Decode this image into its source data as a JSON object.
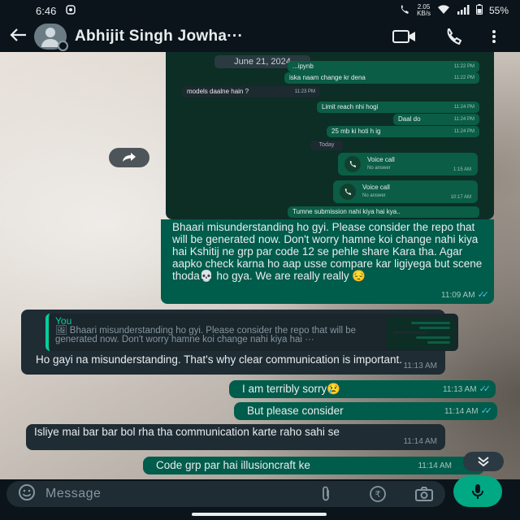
{
  "status_bar": {
    "time": "6:46",
    "net_speed_value": "2.05",
    "net_speed_unit": "KB/s",
    "battery": "55%"
  },
  "header": {
    "contact_name": "Abhijit Singh Jowha···"
  },
  "forwarded_screenshot": {
    "date_chip": "June 21, 2024",
    "messages": [
      {
        "text": "...ipynb",
        "time": "11:22 PM",
        "dir": "out"
      },
      {
        "text": "iska naam change kr dena",
        "time": "11:22 PM",
        "dir": "out"
      },
      {
        "text": "models daalne hain ?",
        "time": "11:23 PM",
        "dir": "in"
      },
      {
        "text": "Limit reach nhi hogi",
        "time": "11:24 PM",
        "dir": "out"
      },
      {
        "text": "Daal do",
        "time": "11:24 PM",
        "dir": "out"
      },
      {
        "text": "25 mb ki hoti h ig",
        "time": "11:24 PM",
        "dir": "out"
      }
    ],
    "today_chip": "Today",
    "calls": [
      {
        "title": "Voice call",
        "status": "No answer",
        "time": "1:15 AM"
      },
      {
        "title": "Voice call",
        "status": "No answer",
        "time": "10:17 AM"
      }
    ],
    "last_line": "Tumne submission nahi kiya hai kya.."
  },
  "messages": [
    {
      "dir": "out",
      "text": "Bhaari misunderstanding ho gyi. Please consider the repo that will be generated now. Don't worry hamne koi change nahi kiya hai Kshitij ne grp par code 12 se pehle share Kara tha. Agar aapko check karna ho aap usse compare kar ligiyega but scene thoda💀 ho gya. We are really really 😔",
      "time": "11:09 AM"
    },
    {
      "dir": "in",
      "quote_author": "You",
      "quote_text": "🖼 Bhaari misunderstanding ho gyi. Please consider the repo that will be generated now. Don't worry hamne koi change nahi kiya hai ···",
      "text": "Ho gayi na misunderstanding. That's why clear communication is important.",
      "time": "11:13 AM"
    },
    {
      "dir": "out",
      "text": "I am terribly sorry😢",
      "time": "11:13 AM"
    },
    {
      "dir": "out",
      "text": "But please consider",
      "time": "11:14 AM"
    },
    {
      "dir": "in",
      "text": "Isliye mai bar bar bol rha tha communication karte raho sahi se",
      "time": "11:14 AM"
    },
    {
      "dir": "out",
      "text": "Code grp par hai illusioncraft ke",
      "time": "11:14 AM"
    }
  ],
  "input": {
    "placeholder": "Message"
  },
  "colors": {
    "bubble_out": "#005c4b",
    "bubble_in": "#1f2c34",
    "accent": "#00a884",
    "read_ticks": "#53bdeb"
  }
}
